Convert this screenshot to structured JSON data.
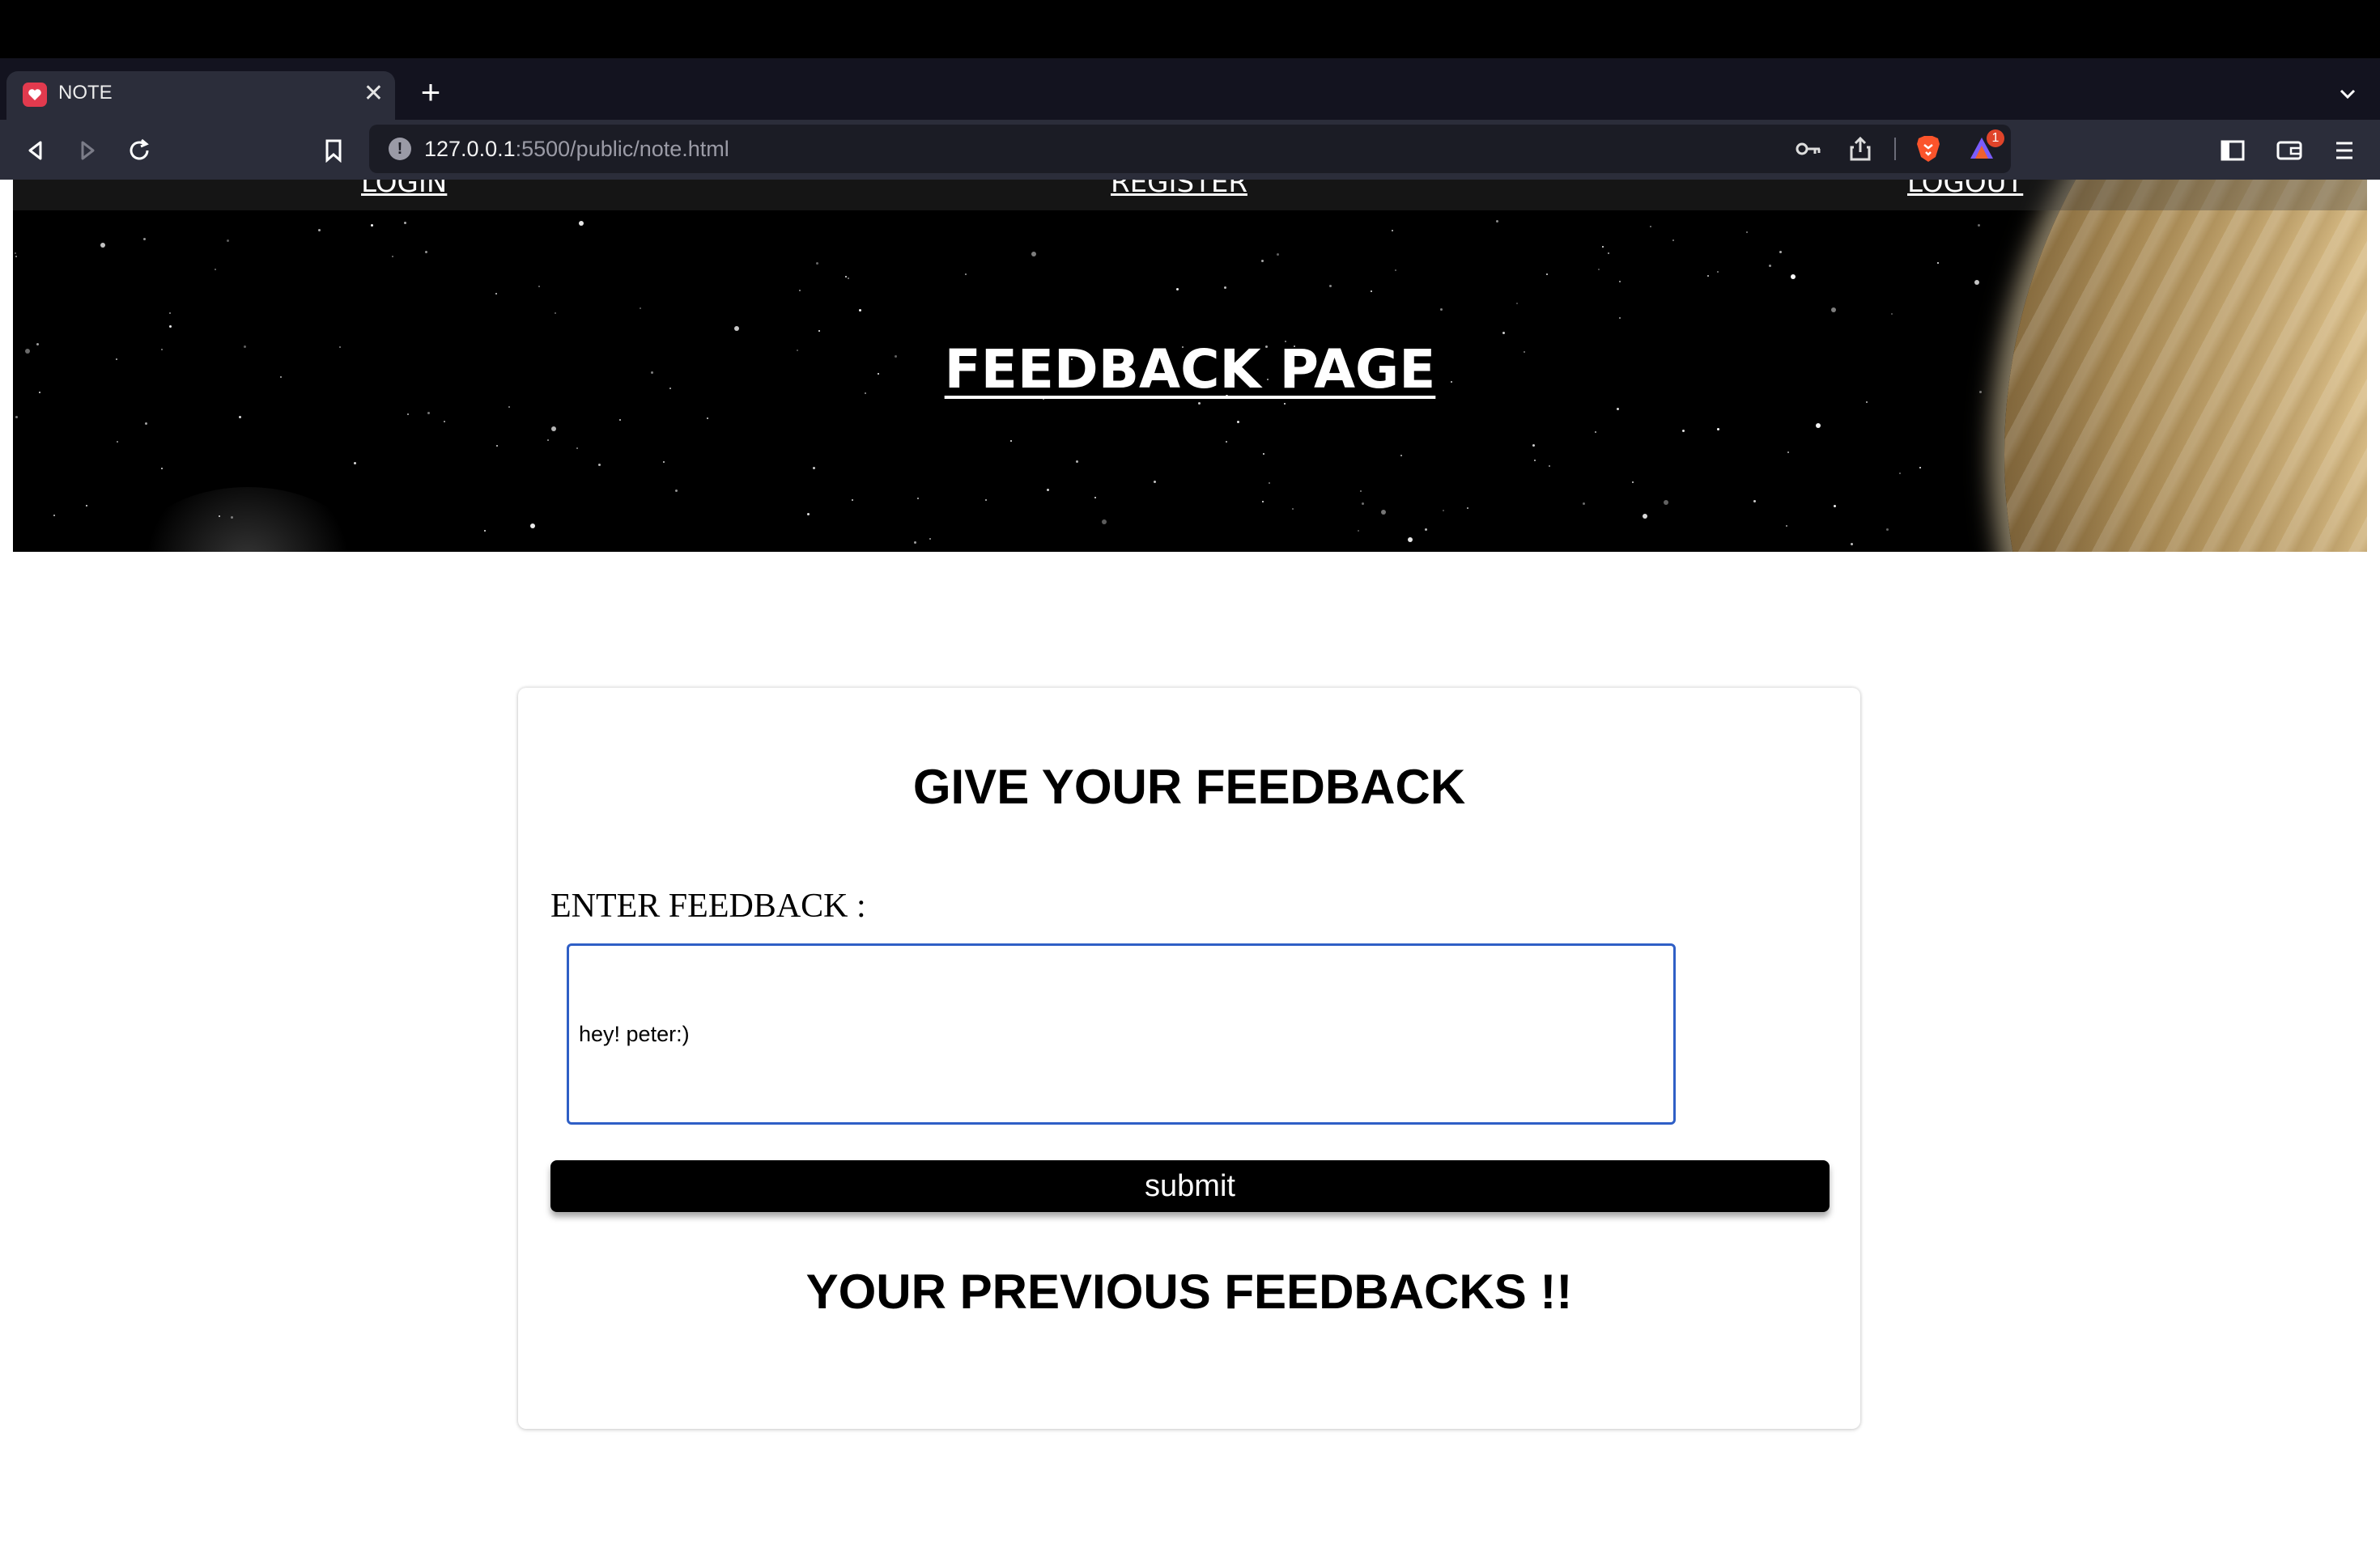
{
  "browser": {
    "tab": {
      "title": "NOTE"
    },
    "url": {
      "host": "127.0.0.1",
      "rest": ":5500/public/note.html"
    },
    "rewards_badge": "1"
  },
  "nav": {
    "login": "LOGIN",
    "register": "REGISTER",
    "logout": "LOGOUT"
  },
  "hero": {
    "title": "FEEDBACK PAGE"
  },
  "form": {
    "heading": "GIVE YOUR FEEDBACK",
    "label": "ENTER FEEDBACK :",
    "value": "hey! peter:)",
    "submit_label": "submit"
  },
  "previous": {
    "heading": "YOUR PREVIOUS FEEDBACKS !!"
  }
}
